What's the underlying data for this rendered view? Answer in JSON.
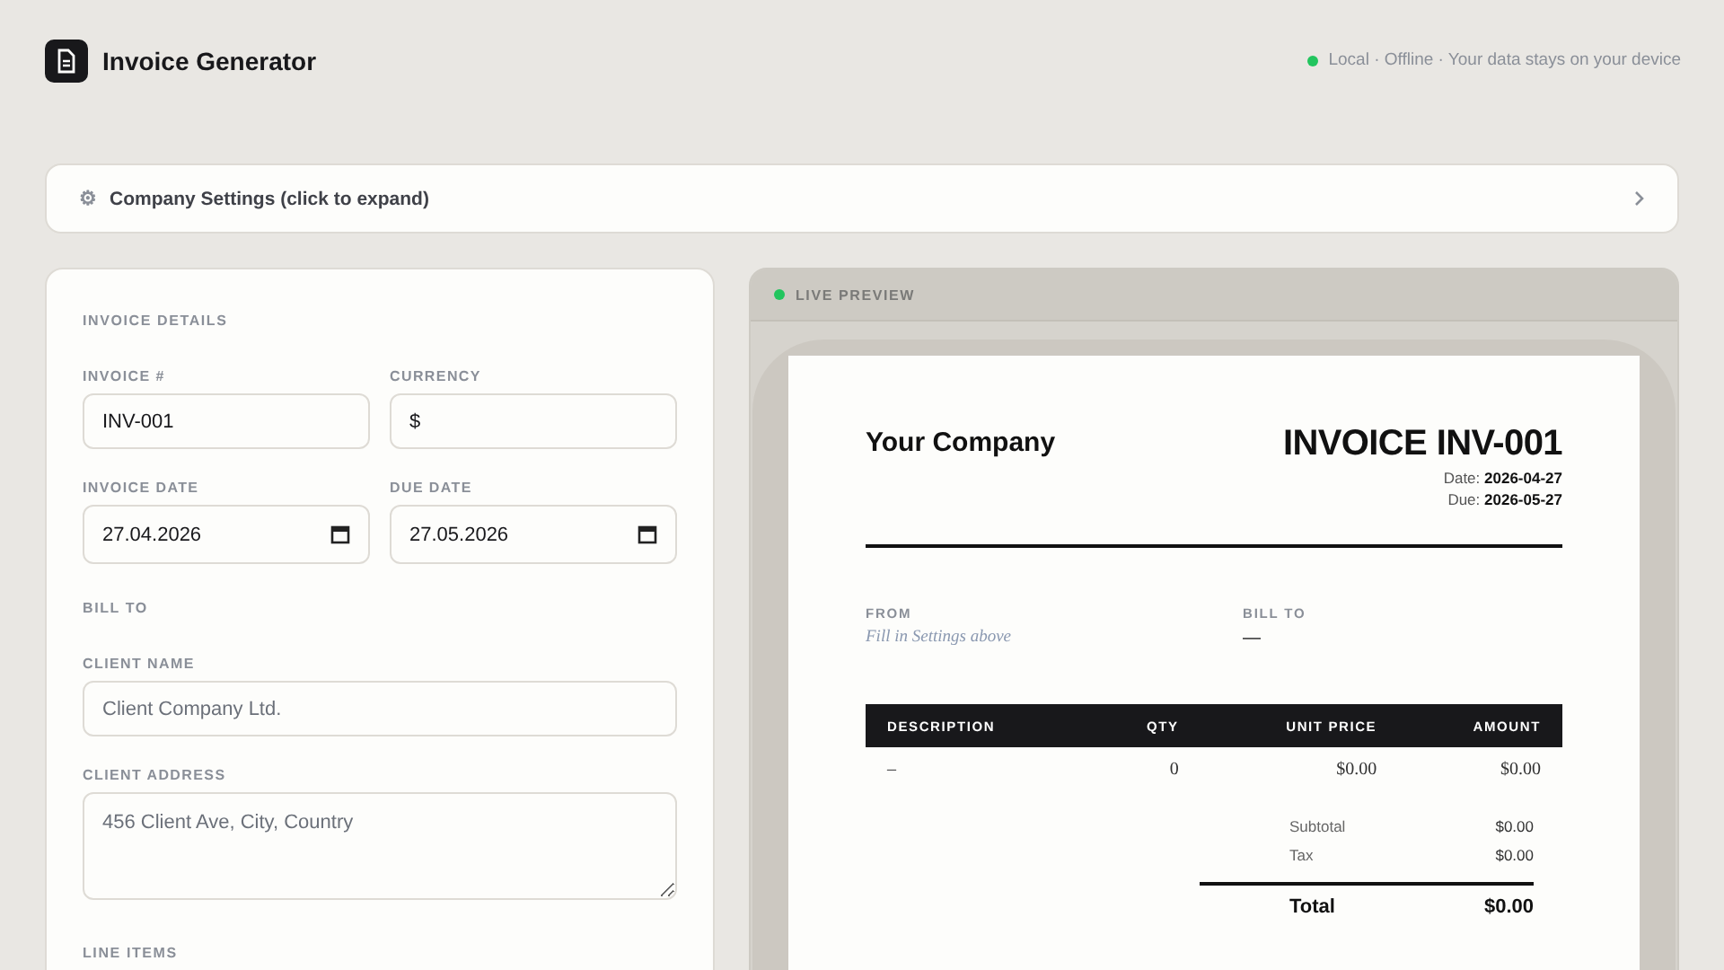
{
  "header": {
    "title": "Invoice Generator",
    "status": "Local · Offline · Your data stays on your device"
  },
  "company_settings": {
    "icon": "⚙",
    "label": "Company Settings (click to expand)",
    "expanded": false
  },
  "form": {
    "sections": [
      {
        "heading": "INVOICE DETAILS",
        "fields": [
          {
            "kind": "text",
            "label": "INVOICE #",
            "value": "INV-001"
          },
          {
            "kind": "text",
            "label": "CURRENCY",
            "value": "$"
          },
          {
            "kind": "date",
            "label": "INVOICE DATE",
            "value": "27.04.2026"
          },
          {
            "kind": "date",
            "label": "DUE DATE",
            "value": "27.05.2026"
          }
        ]
      },
      {
        "heading": "BILL TO",
        "fields": [
          {
            "kind": "text",
            "wide": true,
            "label": "CLIENT NAME",
            "placeholder": "Client Company Ltd."
          },
          {
            "kind": "textarea",
            "wide": true,
            "label": "CLIENT ADDRESS",
            "placeholder": "456 Client Ave, City, Country"
          }
        ]
      },
      {
        "heading": "LINE ITEMS"
      }
    ]
  },
  "preview": {
    "label": "LIVE PREVIEW",
    "document": {
      "company": "Your Company",
      "title": "INVOICE INV-001",
      "dates": [
        "Date: **2026-04-27**",
        "Due: **2026-05-27**"
      ],
      "parties": [
        {
          "label": "FROM",
          "text": "Fill in Settings above",
          "kind": "hint"
        },
        {
          "label": "BILL TO",
          "text": "—",
          "kind": "plain"
        }
      ],
      "table": {
        "columns": [
          "DESCRIPTION",
          "QTY",
          "UNIT PRICE",
          "AMOUNT"
        ],
        "rows": [
          [
            "–",
            "0",
            "$0.00",
            "$0.00"
          ]
        ]
      },
      "totals": [
        {
          "kind": "sub",
          "label": "Subtotal",
          "value": "$0.00"
        },
        {
          "kind": "sub",
          "label": "Tax",
          "value": "$0.00"
        },
        {
          "kind": "total",
          "label": "Total",
          "value": "$0.00"
        }
      ]
    }
  }
}
